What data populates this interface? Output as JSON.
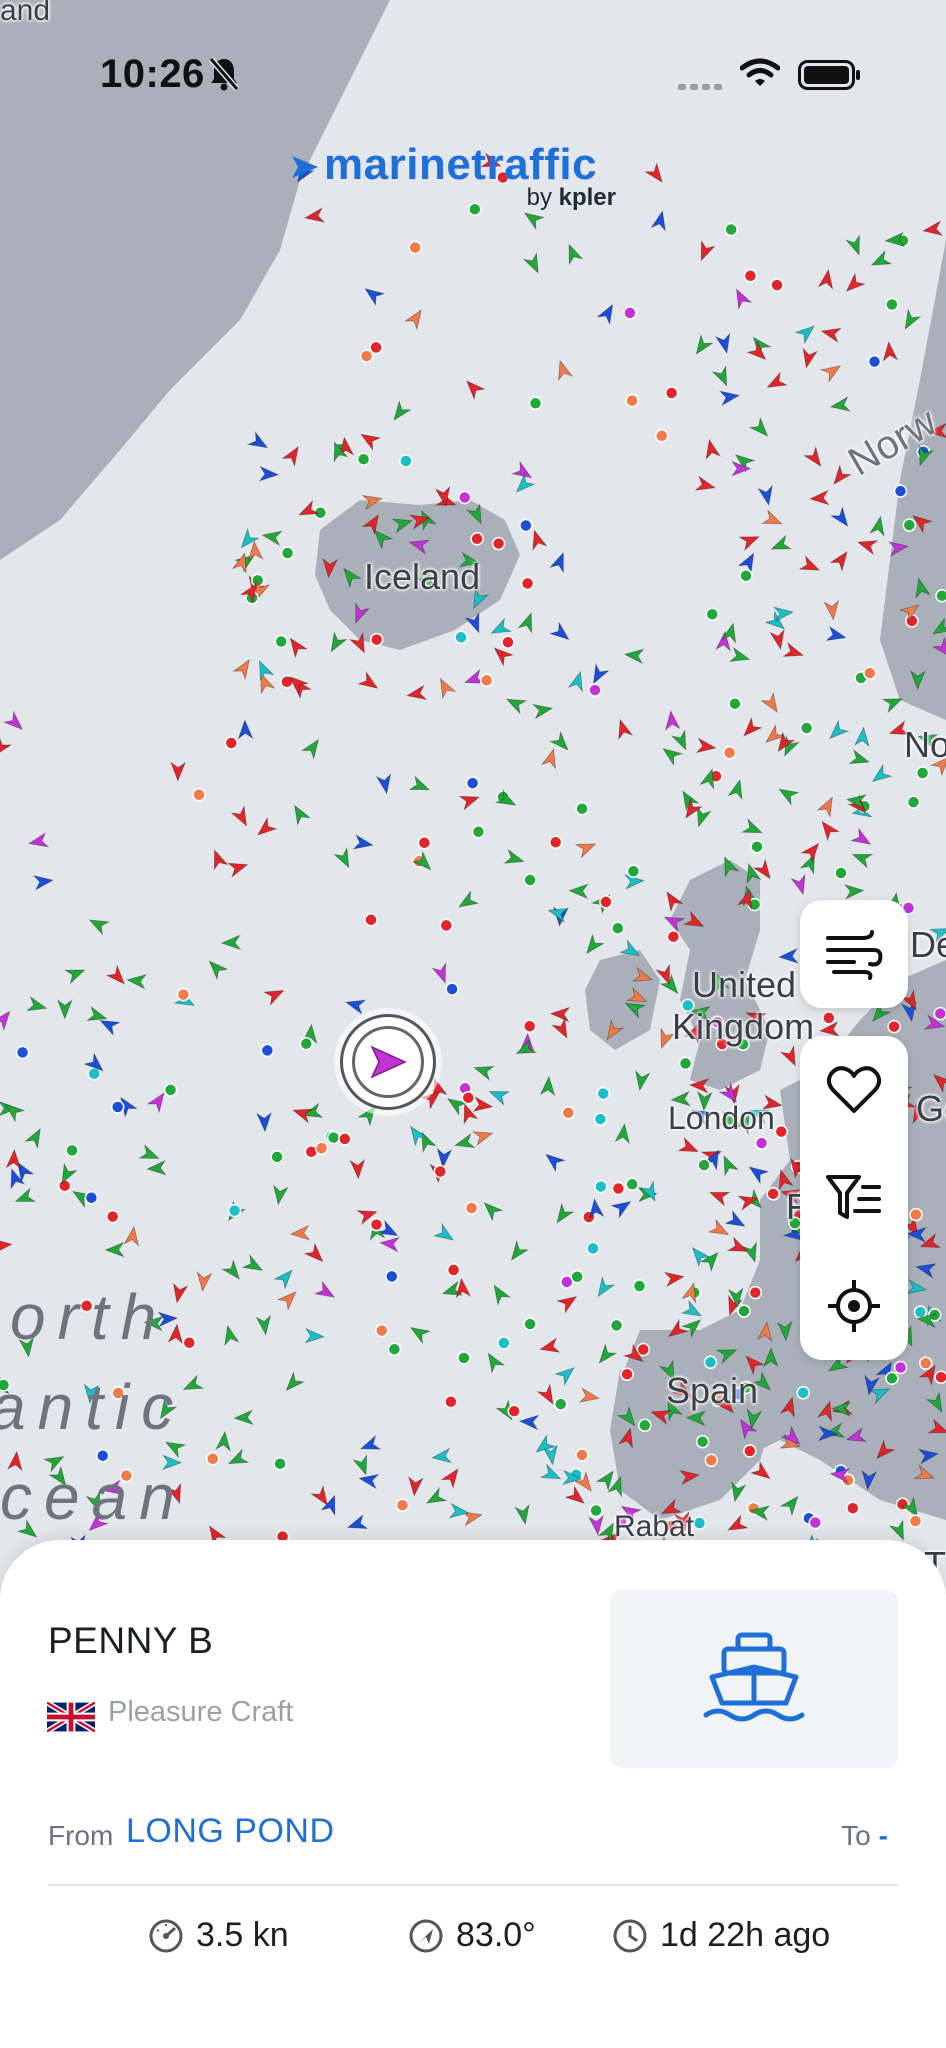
{
  "status_bar": {
    "time": "10:26"
  },
  "brand": {
    "name": "marinetraffic",
    "by": "by",
    "company": "kpler"
  },
  "map": {
    "labels": {
      "iceland": "Iceland",
      "uk_line1": "United",
      "uk_line2": "Kingdom",
      "london": "London",
      "spain": "Spain",
      "norway_partial": "Norw",
      "edge_no": "No",
      "edge_de": "De",
      "edge_ge": "Ge",
      "edge_f": "F",
      "edge_t": "T",
      "edge_land": "and",
      "rabat_partial": "Rabat"
    },
    "ocean": {
      "line1": "orth",
      "line2": "antic",
      "line3": "cean"
    }
  },
  "controls": [
    "wind-layer",
    "favorites",
    "filter",
    "locate-me"
  ],
  "vessel": {
    "name": "PENNY B",
    "flag": "united-kingdom-flag",
    "type": "Pleasure Craft",
    "from_label": "From",
    "from_value": "LONG POND",
    "to_label": "To",
    "to_value": "-",
    "speed": "3.5 kn",
    "course": "83.0°",
    "last_update": "1d 22h ago"
  },
  "colors": {
    "accent": "#1f6fd8",
    "land": "#a6adb6",
    "water": "#dfe3e8"
  }
}
